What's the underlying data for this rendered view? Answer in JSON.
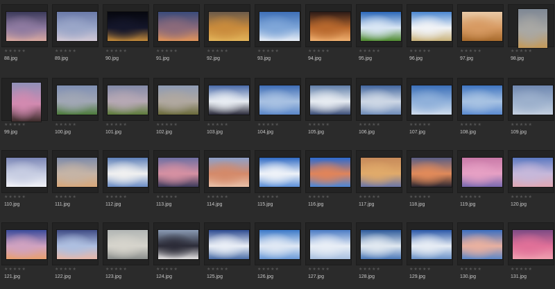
{
  "browser": {
    "star_rating": "★★★★★",
    "items": [
      {
        "file": "88.jpg",
        "colors": [
          "#3b3a5a",
          "#8e7aa0",
          "#d9a9a0"
        ]
      },
      {
        "file": "89.jpg",
        "colors": [
          "#6a79a8",
          "#9aa6c8",
          "#d3c9d5"
        ]
      },
      {
        "file": "90.jpg",
        "colors": [
          "#06070e",
          "#14162a",
          "#c38a3a"
        ]
      },
      {
        "file": "91.jpg",
        "colors": [
          "#3a4b7a",
          "#8b6a7a",
          "#e0945a"
        ]
      },
      {
        "file": "92.jpg",
        "colors": [
          "#6b5a4a",
          "#c98b3c",
          "#e2b45a"
        ]
      },
      {
        "file": "93.jpg",
        "colors": [
          "#3e6fb6",
          "#7fa6d8",
          "#e8eef6"
        ]
      },
      {
        "file": "94.jpg",
        "colors": [
          "#2b1a16",
          "#b8682d",
          "#f0b070"
        ]
      },
      {
        "file": "95.jpg",
        "colors": [
          "#2a66b8",
          "#d9e6f4",
          "#4e8a2e"
        ]
      },
      {
        "file": "96.jpg",
        "colors": [
          "#4a86d0",
          "#f1f3f6",
          "#c9b27a"
        ]
      },
      {
        "file": "97.jpg",
        "colors": [
          "#e9c9a6",
          "#d79a62",
          "#a76a2c"
        ]
      },
      {
        "file": "98.jpg",
        "colors": [
          "#7e8794",
          "#a9a8a4",
          "#c49a5a"
        ],
        "portrait": true
      },
      {
        "file": "99.jpg",
        "colors": [
          "#9090b8",
          "#d28ab0",
          "#3b2b2a"
        ],
        "portrait": true
      },
      {
        "file": "100.jpg",
        "colors": [
          "#7f8fb3",
          "#a1a7b5",
          "#4c7a3a"
        ]
      },
      {
        "file": "101.jpg",
        "colors": [
          "#838aa8",
          "#b6a8b4",
          "#5d7b3a"
        ]
      },
      {
        "file": "102.jpg",
        "colors": [
          "#8e9bb4",
          "#b0a8a0",
          "#6a6a3a"
        ]
      },
      {
        "file": "103.jpg",
        "colors": [
          "#4a6aa8",
          "#e7ecf2",
          "#2a2a3a"
        ]
      },
      {
        "file": "104.jpg",
        "colors": [
          "#3e6db6",
          "#a8c1e2",
          "#5a86c8"
        ]
      },
      {
        "file": "105.jpg",
        "colors": [
          "#5f7da8",
          "#e6ebf1",
          "#3b4e78"
        ]
      },
      {
        "file": "106.jpg",
        "colors": [
          "#41659e",
          "#cdd7e5",
          "#6e8bb8"
        ]
      },
      {
        "file": "107.jpg",
        "colors": [
          "#3b6fb8",
          "#8fb0da",
          "#cfdcec"
        ]
      },
      {
        "file": "108.jpg",
        "colors": [
          "#3e74c0",
          "#a7c2e2",
          "#5b8ad0"
        ]
      },
      {
        "file": "109.jpg",
        "colors": [
          "#7088b0",
          "#9cb0cc",
          "#c3cfdf"
        ]
      },
      {
        "file": "110.jpg",
        "colors": [
          "#7b86b6",
          "#c7cde2",
          "#f1f2f7"
        ]
      },
      {
        "file": "111.jpg",
        "colors": [
          "#7d8aa8",
          "#c5b4a6",
          "#d8a87a"
        ]
      },
      {
        "file": "112.jpg",
        "colors": [
          "#5d7fb8",
          "#f0f0f0",
          "#6a8cc4"
        ]
      },
      {
        "file": "113.jpg",
        "colors": [
          "#6e6fa2",
          "#d590a2",
          "#3b3a5a"
        ]
      },
      {
        "file": "114.jpg",
        "colors": [
          "#8ea0c8",
          "#d48a6a",
          "#e9c0a8"
        ]
      },
      {
        "file": "115.jpg",
        "colors": [
          "#2f6ac4",
          "#eef2f8",
          "#5b8fd8"
        ]
      },
      {
        "file": "116.jpg",
        "colors": [
          "#2c6ad0",
          "#e0845a",
          "#4b86d8"
        ]
      },
      {
        "file": "117.jpg",
        "colors": [
          "#c78a5a",
          "#e0aa6a",
          "#6a76a8"
        ]
      },
      {
        "file": "118.jpg",
        "colors": [
          "#5a5e84",
          "#e08a5a",
          "#2a2630"
        ]
      },
      {
        "file": "119.jpg",
        "colors": [
          "#c97aa8",
          "#e6a0c4",
          "#7a6ab0"
        ]
      },
      {
        "file": "120.jpg",
        "colors": [
          "#5a78c0",
          "#c6b8da",
          "#e0a8b4"
        ]
      },
      {
        "file": "121.jpg",
        "colors": [
          "#3a4a9a",
          "#d0a2c0",
          "#e9a070"
        ]
      },
      {
        "file": "122.jpg",
        "colors": [
          "#3e4a84",
          "#aebfe0",
          "#e8b8a8"
        ]
      },
      {
        "file": "123.jpg",
        "colors": [
          "#b2b6b4",
          "#d6d4cc",
          "#8b8e8c"
        ]
      },
      {
        "file": "124.jpg",
        "colors": [
          "#8a9bb4",
          "#2c2c38",
          "#e6e4e4"
        ]
      },
      {
        "file": "125.jpg",
        "colors": [
          "#2c4a90",
          "#e9eef6",
          "#4b6ea8"
        ]
      },
      {
        "file": "126.jpg",
        "colors": [
          "#3a78c8",
          "#dfe8f4",
          "#6a9ad8"
        ]
      },
      {
        "file": "127.jpg",
        "colors": [
          "#4a7ac4",
          "#e8eef6",
          "#a8c0e0"
        ]
      },
      {
        "file": "128.jpg",
        "colors": [
          "#2c5a9a",
          "#e0e8f0",
          "#4a78b8"
        ]
      },
      {
        "file": "129.jpg",
        "colors": [
          "#2a58a8",
          "#e6ecf4",
          "#6a92c8"
        ]
      },
      {
        "file": "130.jpg",
        "colors": [
          "#3a6ec0",
          "#e8b0a0",
          "#5a86c8"
        ]
      },
      {
        "file": "131.jpg",
        "colors": [
          "#7c4a84",
          "#e07098",
          "#f0a0b0"
        ]
      }
    ]
  }
}
